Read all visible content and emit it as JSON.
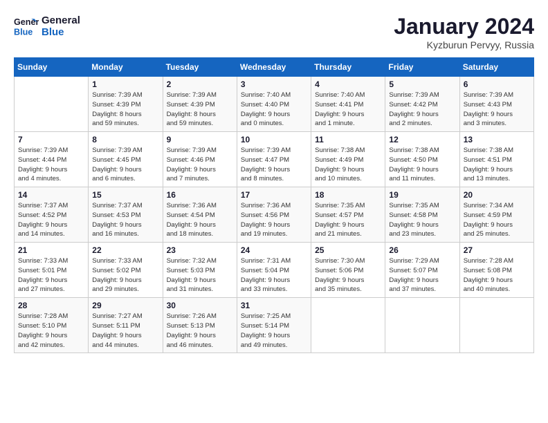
{
  "logo": {
    "line1": "General",
    "line2": "Blue"
  },
  "title": "January 2024",
  "subtitle": "Kyzburun Pervyy, Russia",
  "weekdays": [
    "Sunday",
    "Monday",
    "Tuesday",
    "Wednesday",
    "Thursday",
    "Friday",
    "Saturday"
  ],
  "weeks": [
    [
      {
        "day": "",
        "info": ""
      },
      {
        "day": "1",
        "info": "Sunrise: 7:39 AM\nSunset: 4:39 PM\nDaylight: 8 hours\nand 59 minutes."
      },
      {
        "day": "2",
        "info": "Sunrise: 7:39 AM\nSunset: 4:39 PM\nDaylight: 8 hours\nand 59 minutes."
      },
      {
        "day": "3",
        "info": "Sunrise: 7:40 AM\nSunset: 4:40 PM\nDaylight: 9 hours\nand 0 minutes."
      },
      {
        "day": "4",
        "info": "Sunrise: 7:40 AM\nSunset: 4:41 PM\nDaylight: 9 hours\nand 1 minute."
      },
      {
        "day": "5",
        "info": "Sunrise: 7:39 AM\nSunset: 4:42 PM\nDaylight: 9 hours\nand 2 minutes."
      },
      {
        "day": "6",
        "info": "Sunrise: 7:39 AM\nSunset: 4:43 PM\nDaylight: 9 hours\nand 3 minutes."
      }
    ],
    [
      {
        "day": "7",
        "info": "Sunrise: 7:39 AM\nSunset: 4:44 PM\nDaylight: 9 hours\nand 4 minutes."
      },
      {
        "day": "8",
        "info": "Sunrise: 7:39 AM\nSunset: 4:45 PM\nDaylight: 9 hours\nand 6 minutes."
      },
      {
        "day": "9",
        "info": "Sunrise: 7:39 AM\nSunset: 4:46 PM\nDaylight: 9 hours\nand 7 minutes."
      },
      {
        "day": "10",
        "info": "Sunrise: 7:39 AM\nSunset: 4:47 PM\nDaylight: 9 hours\nand 8 minutes."
      },
      {
        "day": "11",
        "info": "Sunrise: 7:38 AM\nSunset: 4:49 PM\nDaylight: 9 hours\nand 10 minutes."
      },
      {
        "day": "12",
        "info": "Sunrise: 7:38 AM\nSunset: 4:50 PM\nDaylight: 9 hours\nand 11 minutes."
      },
      {
        "day": "13",
        "info": "Sunrise: 7:38 AM\nSunset: 4:51 PM\nDaylight: 9 hours\nand 13 minutes."
      }
    ],
    [
      {
        "day": "14",
        "info": "Sunrise: 7:37 AM\nSunset: 4:52 PM\nDaylight: 9 hours\nand 14 minutes."
      },
      {
        "day": "15",
        "info": "Sunrise: 7:37 AM\nSunset: 4:53 PM\nDaylight: 9 hours\nand 16 minutes."
      },
      {
        "day": "16",
        "info": "Sunrise: 7:36 AM\nSunset: 4:54 PM\nDaylight: 9 hours\nand 18 minutes."
      },
      {
        "day": "17",
        "info": "Sunrise: 7:36 AM\nSunset: 4:56 PM\nDaylight: 9 hours\nand 19 minutes."
      },
      {
        "day": "18",
        "info": "Sunrise: 7:35 AM\nSunset: 4:57 PM\nDaylight: 9 hours\nand 21 minutes."
      },
      {
        "day": "19",
        "info": "Sunrise: 7:35 AM\nSunset: 4:58 PM\nDaylight: 9 hours\nand 23 minutes."
      },
      {
        "day": "20",
        "info": "Sunrise: 7:34 AM\nSunset: 4:59 PM\nDaylight: 9 hours\nand 25 minutes."
      }
    ],
    [
      {
        "day": "21",
        "info": "Sunrise: 7:33 AM\nSunset: 5:01 PM\nDaylight: 9 hours\nand 27 minutes."
      },
      {
        "day": "22",
        "info": "Sunrise: 7:33 AM\nSunset: 5:02 PM\nDaylight: 9 hours\nand 29 minutes."
      },
      {
        "day": "23",
        "info": "Sunrise: 7:32 AM\nSunset: 5:03 PM\nDaylight: 9 hours\nand 31 minutes."
      },
      {
        "day": "24",
        "info": "Sunrise: 7:31 AM\nSunset: 5:04 PM\nDaylight: 9 hours\nand 33 minutes."
      },
      {
        "day": "25",
        "info": "Sunrise: 7:30 AM\nSunset: 5:06 PM\nDaylight: 9 hours\nand 35 minutes."
      },
      {
        "day": "26",
        "info": "Sunrise: 7:29 AM\nSunset: 5:07 PM\nDaylight: 9 hours\nand 37 minutes."
      },
      {
        "day": "27",
        "info": "Sunrise: 7:28 AM\nSunset: 5:08 PM\nDaylight: 9 hours\nand 40 minutes."
      }
    ],
    [
      {
        "day": "28",
        "info": "Sunrise: 7:28 AM\nSunset: 5:10 PM\nDaylight: 9 hours\nand 42 minutes."
      },
      {
        "day": "29",
        "info": "Sunrise: 7:27 AM\nSunset: 5:11 PM\nDaylight: 9 hours\nand 44 minutes."
      },
      {
        "day": "30",
        "info": "Sunrise: 7:26 AM\nSunset: 5:13 PM\nDaylight: 9 hours\nand 46 minutes."
      },
      {
        "day": "31",
        "info": "Sunrise: 7:25 AM\nSunset: 5:14 PM\nDaylight: 9 hours\nand 49 minutes."
      },
      {
        "day": "",
        "info": ""
      },
      {
        "day": "",
        "info": ""
      },
      {
        "day": "",
        "info": ""
      }
    ]
  ]
}
